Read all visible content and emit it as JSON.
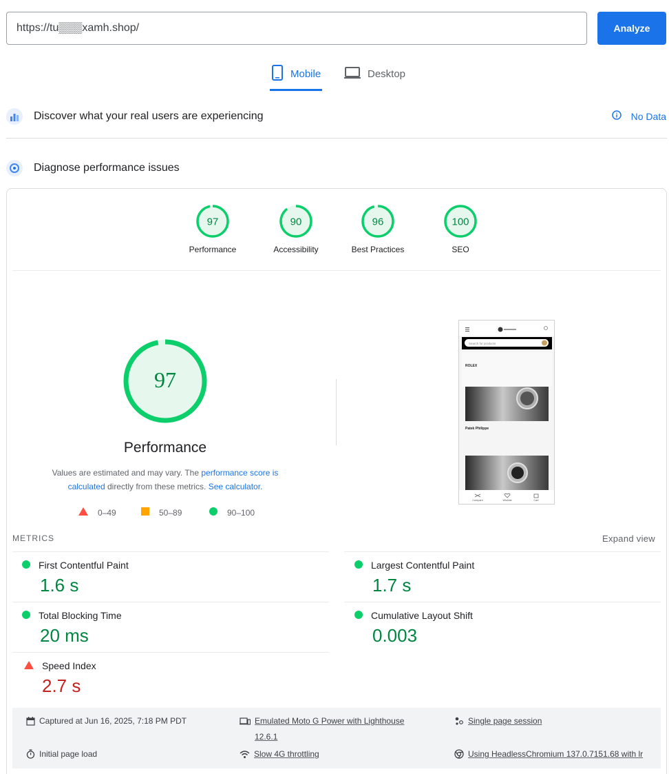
{
  "search": {
    "url": "https://tu▒▒▒xamh.shop/",
    "analyze_label": "Analyze"
  },
  "tabs": [
    {
      "label": "Mobile"
    },
    {
      "label": "Desktop"
    }
  ],
  "discover": {
    "title": "Discover what your real users are experiencing",
    "status": "No Data"
  },
  "diagnose": {
    "title": "Diagnose performance issues"
  },
  "scores": [
    {
      "label": "Performance",
      "value": "97"
    },
    {
      "label": "Accessibility",
      "value": "90"
    },
    {
      "label": "Best Practices",
      "value": "96"
    },
    {
      "label": "SEO",
      "value": "100"
    }
  ],
  "main": {
    "score": "97",
    "title": "Performance",
    "disclaimer_pre": "Values are estimated and may vary. The ",
    "disclaimer_link1": "performance score is calculated",
    "disclaimer_mid": " directly from these metrics. ",
    "disclaimer_link2": "See calculator."
  },
  "legend": {
    "fail": "0–49",
    "average": "50–89",
    "pass": "90–100"
  },
  "preview": {
    "search_placeholder": "Search for products",
    "brand1": "ROLEX",
    "brand2": "Patek Philippe",
    "nav": [
      "Compare",
      "Wishlist",
      "Cart"
    ]
  },
  "metrics": {
    "header": "METRICS",
    "expand": "Expand view",
    "items": [
      {
        "label": "First Contentful Paint",
        "value": "1.6 s"
      },
      {
        "label": "Largest Contentful Paint",
        "value": "1.7 s"
      },
      {
        "label": "Total Blocking Time",
        "value": "20 ms"
      },
      {
        "label": "Cumulative Layout Shift",
        "value": "0.003"
      },
      {
        "label": "Speed Index",
        "value": "2.7 s"
      }
    ]
  },
  "info": {
    "captured": "Captured at Jun 16, 2025, 7:18 PM PDT",
    "device": "Emulated Moto G Power with Lighthouse 12.6.1",
    "session": "Single page session",
    "load": "Initial page load",
    "throttle": "Slow 4G throttling",
    "browser": "Using HeadlessChromium 137.0.7151.68 with lr"
  },
  "colors": {
    "accent": "#1a73e8",
    "pass": "#0cce6b",
    "pass_text": "#018642",
    "average": "#ffa400",
    "fail": "#ff4e42"
  }
}
